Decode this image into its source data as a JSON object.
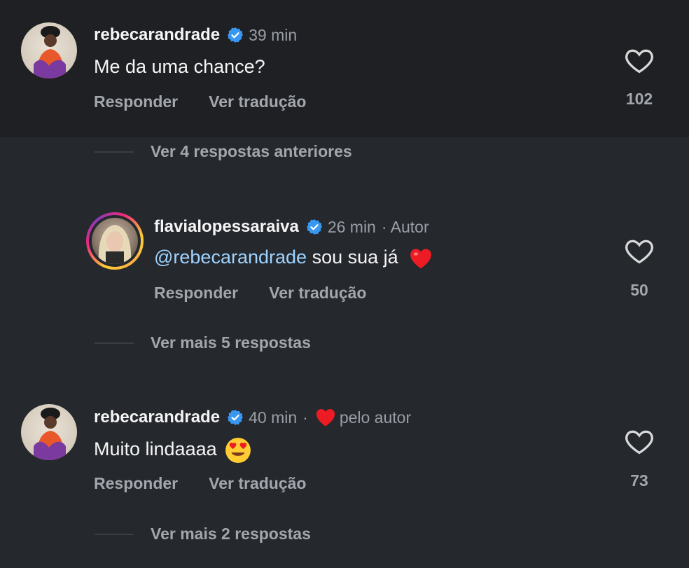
{
  "comments": [
    {
      "username": "rebecarandrade",
      "time": "39 min",
      "text": "Me da uma chance?",
      "reply_label": "Responder",
      "translate_label": "Ver tradução",
      "likes": "102"
    },
    {
      "username": "flavialopessaraiva",
      "time": "26 min",
      "author_tag": "· Autor",
      "mention": "@rebecarandrade",
      "text": "sou sua já",
      "reply_label": "Responder",
      "translate_label": "Ver tradução",
      "likes": "50"
    },
    {
      "username": "rebecarandrade",
      "time": "40 min",
      "separator": "·",
      "liked_by_author": "pelo autor",
      "text": "Muito lindaaaa",
      "reply_label": "Responder",
      "translate_label": "Ver tradução",
      "likes": "73"
    }
  ],
  "threads": {
    "previous": "Ver 4 respostas anteriores",
    "more_first": "Ver mais 5 respostas",
    "more_second": "Ver mais 2 respostas"
  },
  "colors": {
    "background": "#25282d",
    "highlight": "#1e2024",
    "verified": "#3897f0",
    "mention": "#9fd3ff",
    "heart": "#ed1c24"
  },
  "icons": [
    "verified-badge-icon",
    "heart-outline-icon",
    "red-heart-emoji",
    "heart-eyes-emoji"
  ]
}
